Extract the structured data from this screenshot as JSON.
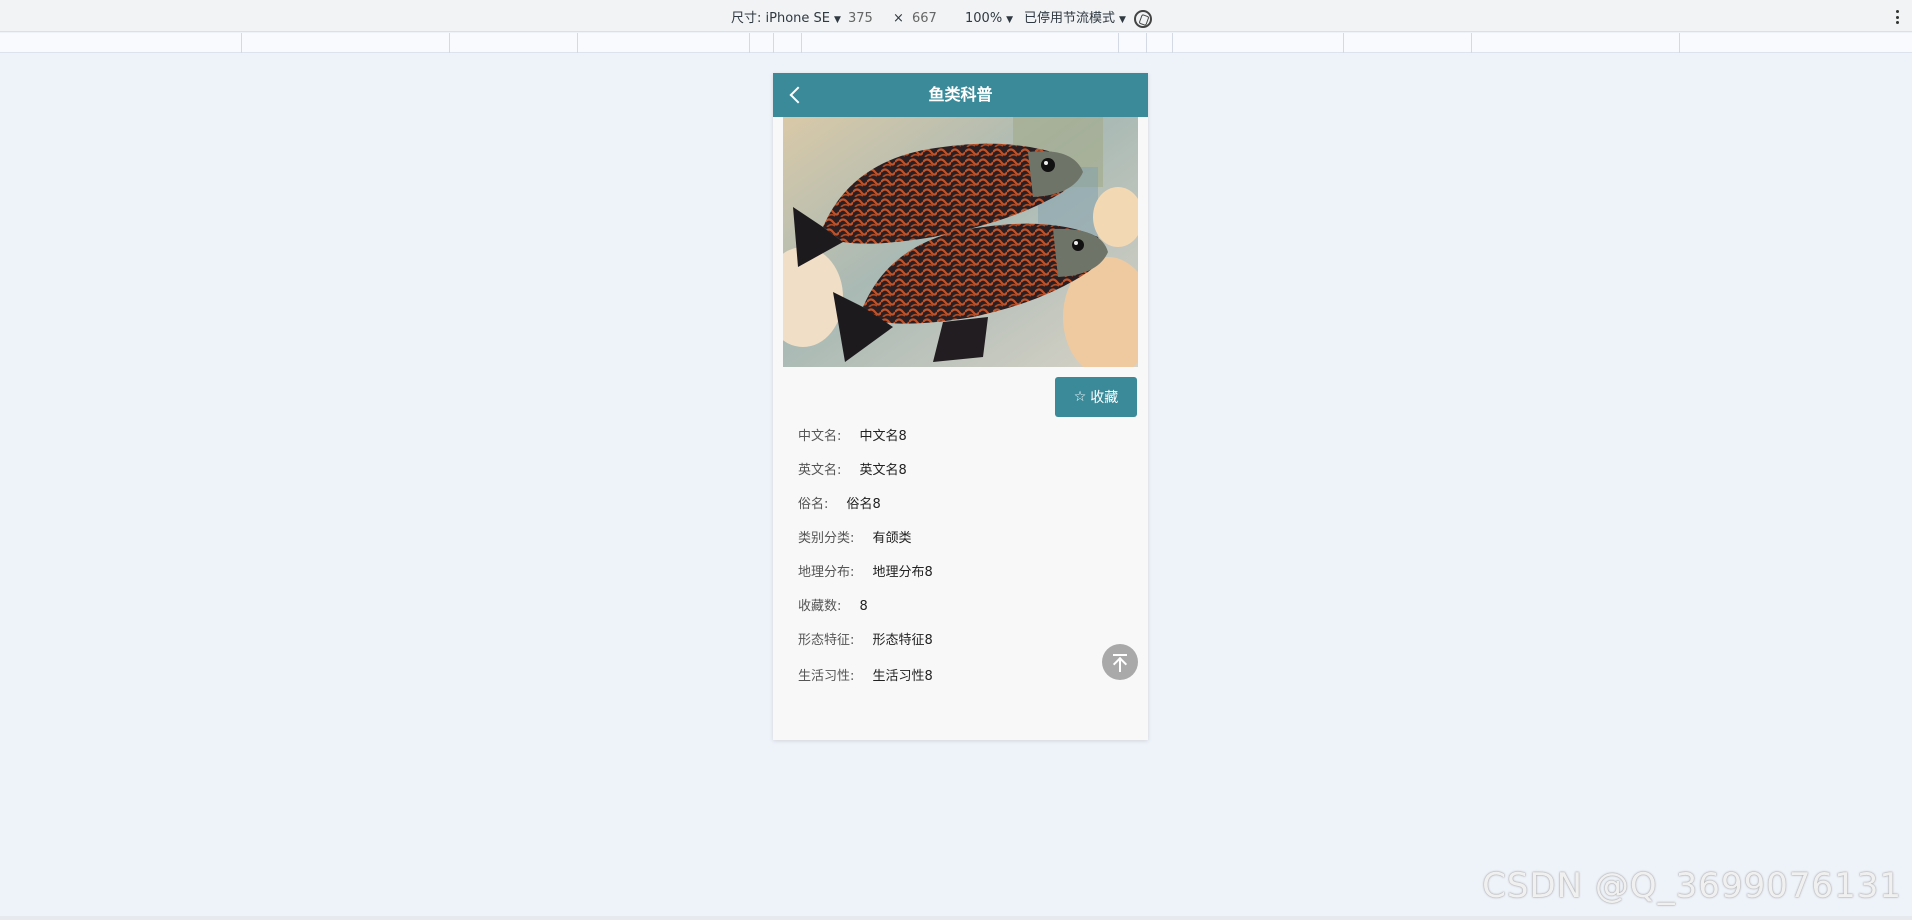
{
  "devtools": {
    "size_label": "尺寸: iPhone SE",
    "width": "375",
    "times": "×",
    "height": "667",
    "zoom": "100%",
    "throttle": "已停用节流模式"
  },
  "app": {
    "title": "鱼类科普",
    "image_icon": "fish-photo",
    "collect_label": "收藏",
    "fields": [
      {
        "label": "中文名:",
        "value": "中文名8"
      },
      {
        "label": "英文名:",
        "value": "英文名8"
      },
      {
        "label": "俗名:",
        "value": "俗名8"
      },
      {
        "label": "类别分类:",
        "value": "有颌类"
      },
      {
        "label": "地理分布:",
        "value": "地理分布8"
      },
      {
        "label": "收藏数:",
        "value": "8"
      },
      {
        "label": "形态特征:",
        "value": "形态特征8"
      },
      {
        "label": "生活习性:",
        "value": "生活习性8"
      }
    ]
  },
  "colors": {
    "accent": "#3a8a9a",
    "page_bg": "#eef2f9"
  },
  "watermark": "CSDN @Q_3699076131"
}
